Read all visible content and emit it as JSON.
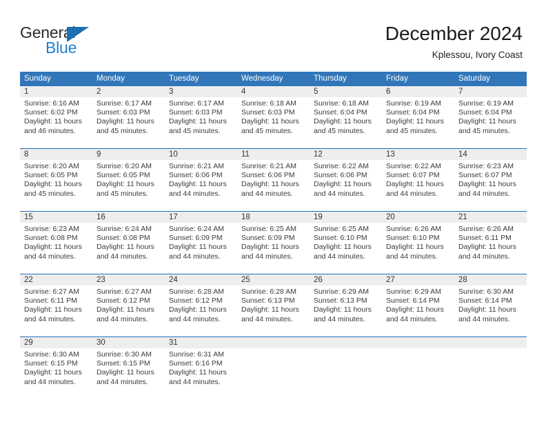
{
  "brand": {
    "name_top": "General",
    "name_bottom": "Blue",
    "triangle_color": "#1b6fb5",
    "blue_text_color": "#2080d0"
  },
  "header": {
    "title": "December 2024",
    "subtitle": "Kplessou, Ivory Coast"
  },
  "theme": {
    "header_blue": "#3176b8",
    "row_divider_blue": "#1e6db4",
    "day_band_gray": "#eeeeee",
    "text_color": "#3a3a3a"
  },
  "weekdays": [
    "Sunday",
    "Monday",
    "Tuesday",
    "Wednesday",
    "Thursday",
    "Friday",
    "Saturday"
  ],
  "weeks": [
    {
      "days": [
        {
          "number": "1",
          "sunrise": "Sunrise: 6:16 AM",
          "sunset": "Sunset: 6:02 PM",
          "daylight_line1": "Daylight: 11 hours",
          "daylight_line2": "and 46 minutes."
        },
        {
          "number": "2",
          "sunrise": "Sunrise: 6:17 AM",
          "sunset": "Sunset: 6:03 PM",
          "daylight_line1": "Daylight: 11 hours",
          "daylight_line2": "and 45 minutes."
        },
        {
          "number": "3",
          "sunrise": "Sunrise: 6:17 AM",
          "sunset": "Sunset: 6:03 PM",
          "daylight_line1": "Daylight: 11 hours",
          "daylight_line2": "and 45 minutes."
        },
        {
          "number": "4",
          "sunrise": "Sunrise: 6:18 AM",
          "sunset": "Sunset: 6:03 PM",
          "daylight_line1": "Daylight: 11 hours",
          "daylight_line2": "and 45 minutes."
        },
        {
          "number": "5",
          "sunrise": "Sunrise: 6:18 AM",
          "sunset": "Sunset: 6:04 PM",
          "daylight_line1": "Daylight: 11 hours",
          "daylight_line2": "and 45 minutes."
        },
        {
          "number": "6",
          "sunrise": "Sunrise: 6:19 AM",
          "sunset": "Sunset: 6:04 PM",
          "daylight_line1": "Daylight: 11 hours",
          "daylight_line2": "and 45 minutes."
        },
        {
          "number": "7",
          "sunrise": "Sunrise: 6:19 AM",
          "sunset": "Sunset: 6:04 PM",
          "daylight_line1": "Daylight: 11 hours",
          "daylight_line2": "and 45 minutes."
        }
      ]
    },
    {
      "days": [
        {
          "number": "8",
          "sunrise": "Sunrise: 6:20 AM",
          "sunset": "Sunset: 6:05 PM",
          "daylight_line1": "Daylight: 11 hours",
          "daylight_line2": "and 45 minutes."
        },
        {
          "number": "9",
          "sunrise": "Sunrise: 6:20 AM",
          "sunset": "Sunset: 6:05 PM",
          "daylight_line1": "Daylight: 11 hours",
          "daylight_line2": "and 45 minutes."
        },
        {
          "number": "10",
          "sunrise": "Sunrise: 6:21 AM",
          "sunset": "Sunset: 6:06 PM",
          "daylight_line1": "Daylight: 11 hours",
          "daylight_line2": "and 44 minutes."
        },
        {
          "number": "11",
          "sunrise": "Sunrise: 6:21 AM",
          "sunset": "Sunset: 6:06 PM",
          "daylight_line1": "Daylight: 11 hours",
          "daylight_line2": "and 44 minutes."
        },
        {
          "number": "12",
          "sunrise": "Sunrise: 6:22 AM",
          "sunset": "Sunset: 6:06 PM",
          "daylight_line1": "Daylight: 11 hours",
          "daylight_line2": "and 44 minutes."
        },
        {
          "number": "13",
          "sunrise": "Sunrise: 6:22 AM",
          "sunset": "Sunset: 6:07 PM",
          "daylight_line1": "Daylight: 11 hours",
          "daylight_line2": "and 44 minutes."
        },
        {
          "number": "14",
          "sunrise": "Sunrise: 6:23 AM",
          "sunset": "Sunset: 6:07 PM",
          "daylight_line1": "Daylight: 11 hours",
          "daylight_line2": "and 44 minutes."
        }
      ]
    },
    {
      "days": [
        {
          "number": "15",
          "sunrise": "Sunrise: 6:23 AM",
          "sunset": "Sunset: 6:08 PM",
          "daylight_line1": "Daylight: 11 hours",
          "daylight_line2": "and 44 minutes."
        },
        {
          "number": "16",
          "sunrise": "Sunrise: 6:24 AM",
          "sunset": "Sunset: 6:08 PM",
          "daylight_line1": "Daylight: 11 hours",
          "daylight_line2": "and 44 minutes."
        },
        {
          "number": "17",
          "sunrise": "Sunrise: 6:24 AM",
          "sunset": "Sunset: 6:09 PM",
          "daylight_line1": "Daylight: 11 hours",
          "daylight_line2": "and 44 minutes."
        },
        {
          "number": "18",
          "sunrise": "Sunrise: 6:25 AM",
          "sunset": "Sunset: 6:09 PM",
          "daylight_line1": "Daylight: 11 hours",
          "daylight_line2": "and 44 minutes."
        },
        {
          "number": "19",
          "sunrise": "Sunrise: 6:25 AM",
          "sunset": "Sunset: 6:10 PM",
          "daylight_line1": "Daylight: 11 hours",
          "daylight_line2": "and 44 minutes."
        },
        {
          "number": "20",
          "sunrise": "Sunrise: 6:26 AM",
          "sunset": "Sunset: 6:10 PM",
          "daylight_line1": "Daylight: 11 hours",
          "daylight_line2": "and 44 minutes."
        },
        {
          "number": "21",
          "sunrise": "Sunrise: 6:26 AM",
          "sunset": "Sunset: 6:11 PM",
          "daylight_line1": "Daylight: 11 hours",
          "daylight_line2": "and 44 minutes."
        }
      ]
    },
    {
      "days": [
        {
          "number": "22",
          "sunrise": "Sunrise: 6:27 AM",
          "sunset": "Sunset: 6:11 PM",
          "daylight_line1": "Daylight: 11 hours",
          "daylight_line2": "and 44 minutes."
        },
        {
          "number": "23",
          "sunrise": "Sunrise: 6:27 AM",
          "sunset": "Sunset: 6:12 PM",
          "daylight_line1": "Daylight: 11 hours",
          "daylight_line2": "and 44 minutes."
        },
        {
          "number": "24",
          "sunrise": "Sunrise: 6:28 AM",
          "sunset": "Sunset: 6:12 PM",
          "daylight_line1": "Daylight: 11 hours",
          "daylight_line2": "and 44 minutes."
        },
        {
          "number": "25",
          "sunrise": "Sunrise: 6:28 AM",
          "sunset": "Sunset: 6:13 PM",
          "daylight_line1": "Daylight: 11 hours",
          "daylight_line2": "and 44 minutes."
        },
        {
          "number": "26",
          "sunrise": "Sunrise: 6:29 AM",
          "sunset": "Sunset: 6:13 PM",
          "daylight_line1": "Daylight: 11 hours",
          "daylight_line2": "and 44 minutes."
        },
        {
          "number": "27",
          "sunrise": "Sunrise: 6:29 AM",
          "sunset": "Sunset: 6:14 PM",
          "daylight_line1": "Daylight: 11 hours",
          "daylight_line2": "and 44 minutes."
        },
        {
          "number": "28",
          "sunrise": "Sunrise: 6:30 AM",
          "sunset": "Sunset: 6:14 PM",
          "daylight_line1": "Daylight: 11 hours",
          "daylight_line2": "and 44 minutes."
        }
      ]
    },
    {
      "days": [
        {
          "number": "29",
          "sunrise": "Sunrise: 6:30 AM",
          "sunset": "Sunset: 6:15 PM",
          "daylight_line1": "Daylight: 11 hours",
          "daylight_line2": "and 44 minutes."
        },
        {
          "number": "30",
          "sunrise": "Sunrise: 6:30 AM",
          "sunset": "Sunset: 6:15 PM",
          "daylight_line1": "Daylight: 11 hours",
          "daylight_line2": "and 44 minutes."
        },
        {
          "number": "31",
          "sunrise": "Sunrise: 6:31 AM",
          "sunset": "Sunset: 6:16 PM",
          "daylight_line1": "Daylight: 11 hours",
          "daylight_line2": "and 44 minutes."
        },
        {
          "number": "",
          "sunrise": "",
          "sunset": "",
          "daylight_line1": "",
          "daylight_line2": ""
        },
        {
          "number": "",
          "sunrise": "",
          "sunset": "",
          "daylight_line1": "",
          "daylight_line2": ""
        },
        {
          "number": "",
          "sunrise": "",
          "sunset": "",
          "daylight_line1": "",
          "daylight_line2": ""
        },
        {
          "number": "",
          "sunrise": "",
          "sunset": "",
          "daylight_line1": "",
          "daylight_line2": ""
        }
      ]
    }
  ]
}
